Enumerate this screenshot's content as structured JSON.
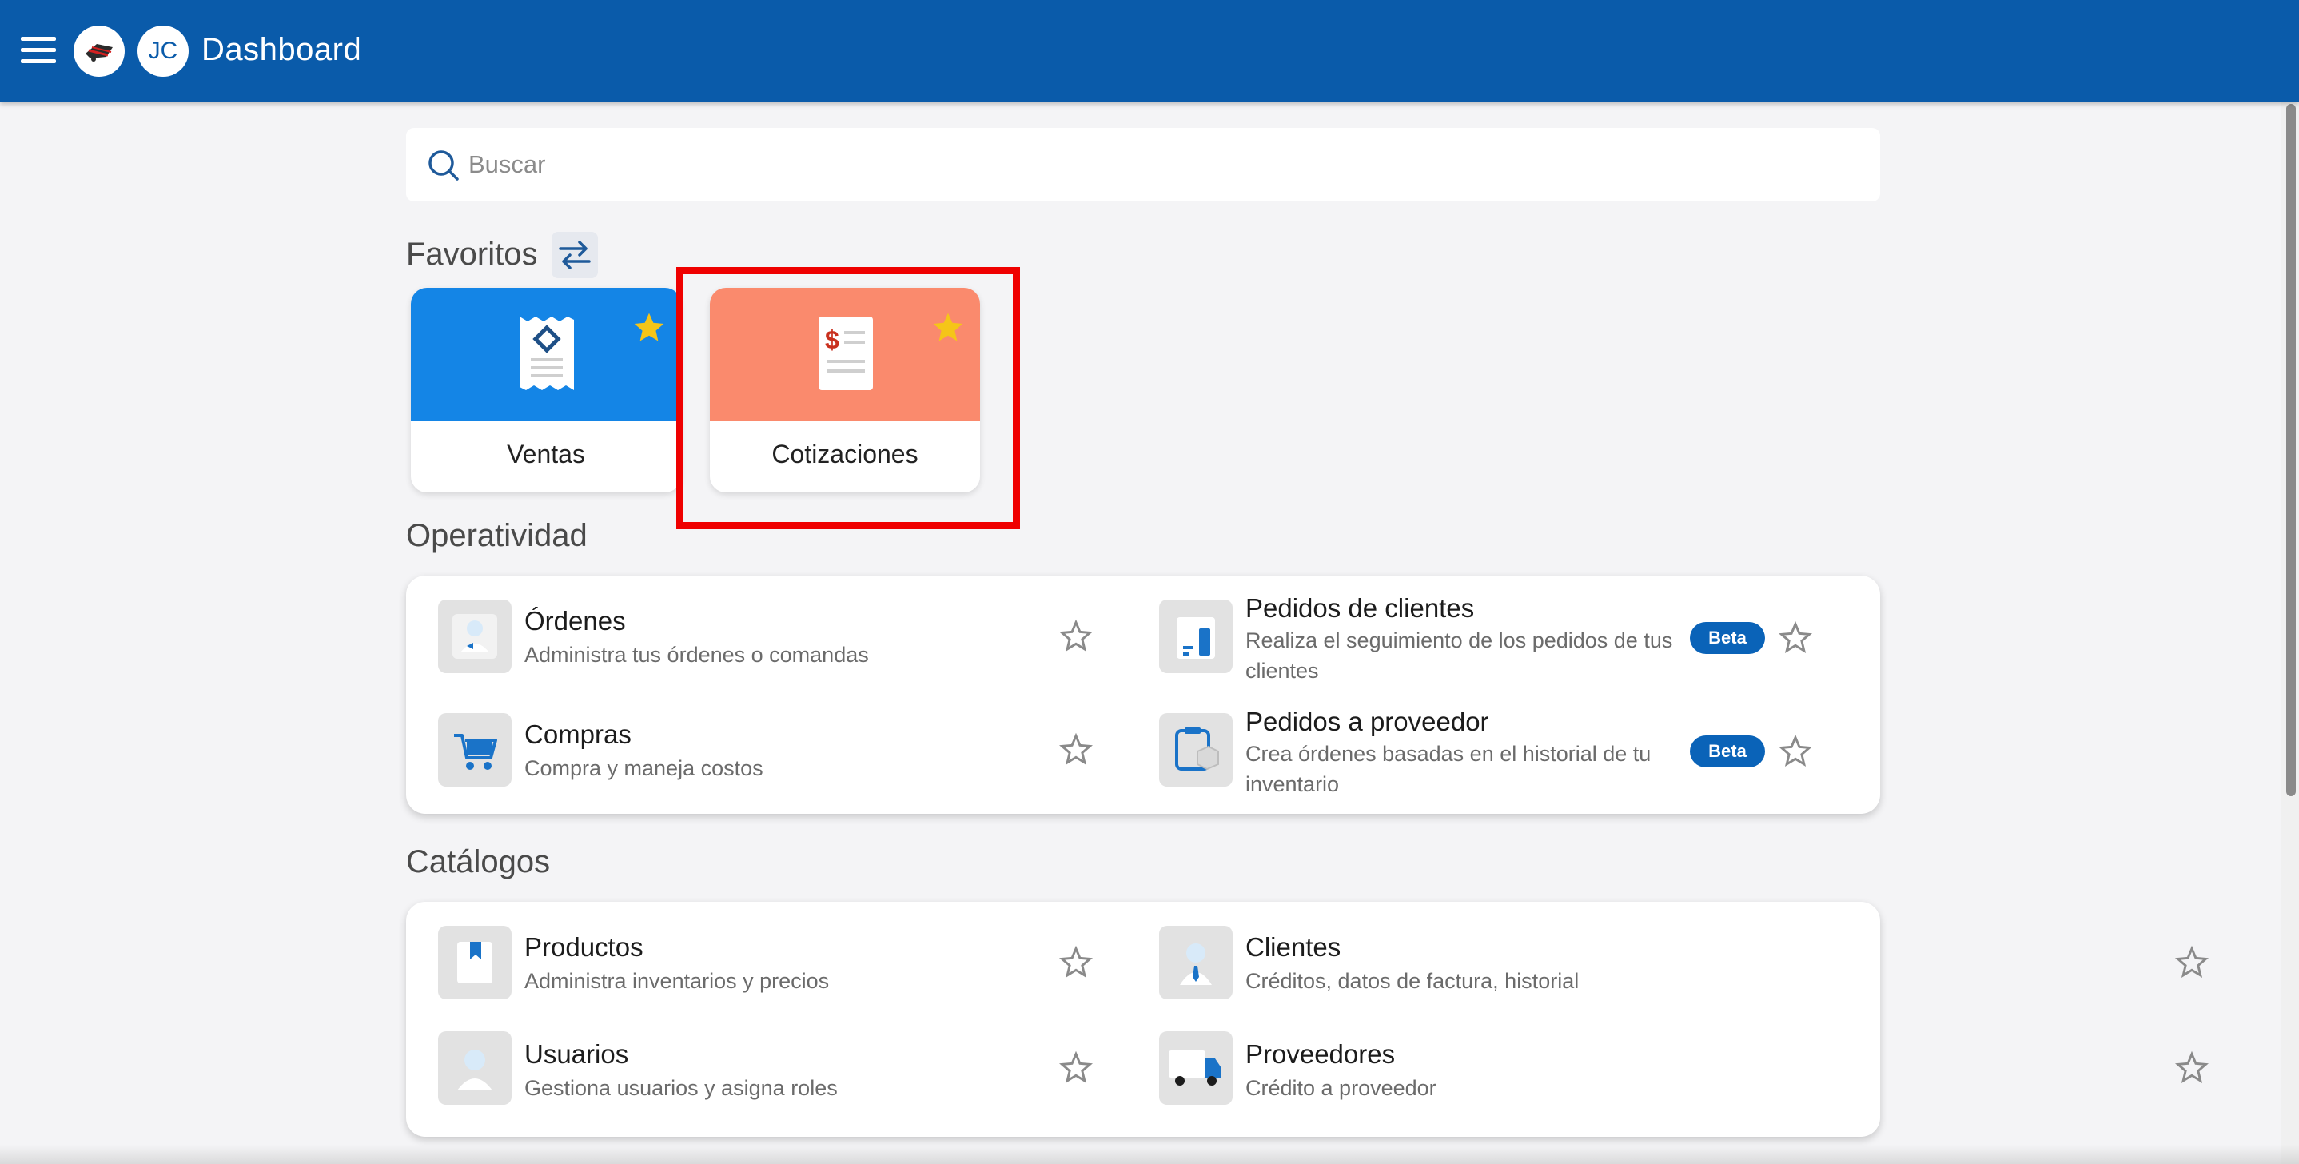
{
  "appbar": {
    "title": "Dashboard",
    "avatar_initials": "JC",
    "color": "#0a5baa"
  },
  "search": {
    "placeholder": "Buscar"
  },
  "favorites": {
    "title": "Favoritos",
    "tiles": [
      {
        "label": "Ventas",
        "color": "#1485e6",
        "icon": "receipt-icon",
        "starred": true
      },
      {
        "label": "Cotizaciones",
        "color": "#fa8a6d",
        "icon": "quote-document-icon",
        "starred": true
      }
    ]
  },
  "operatividad": {
    "title": "Operatividad",
    "items": [
      {
        "title": "Órdenes",
        "subtitle": "Administra tus órdenes o comandas",
        "icon": "orders-icon"
      },
      {
        "title": "Pedidos de clientes",
        "subtitle_line1": "Realiza el seguimiento de los pedidos de tus",
        "subtitle_line2": "clientes",
        "badge": "Beta",
        "icon": "customer-orders-icon"
      },
      {
        "title": "Compras",
        "subtitle": "Compra y maneja costos",
        "icon": "cart-icon"
      },
      {
        "title": "Pedidos a proveedor",
        "subtitle_line1": "Crea órdenes basadas en el historial de tu",
        "subtitle_line2": "inventario",
        "badge": "Beta",
        "icon": "supplier-orders-icon"
      }
    ]
  },
  "catalogos": {
    "title": "Catálogos",
    "items": [
      {
        "title": "Productos",
        "subtitle": "Administra inventarios y precios",
        "icon": "product-icon"
      },
      {
        "title": "Clientes",
        "subtitle": "Créditos, datos de factura, historial",
        "icon": "client-icon"
      },
      {
        "title": "Usuarios",
        "subtitle": "Gestiona usuarios y asigna roles",
        "icon": "user-icon"
      },
      {
        "title": "Proveedores",
        "subtitle": "Crédito a proveedor",
        "icon": "truck-icon"
      }
    ]
  },
  "colors": {
    "beta_badge": "#0a63b8",
    "highlight": "#ef0000",
    "star_filled": "#f5c518"
  }
}
